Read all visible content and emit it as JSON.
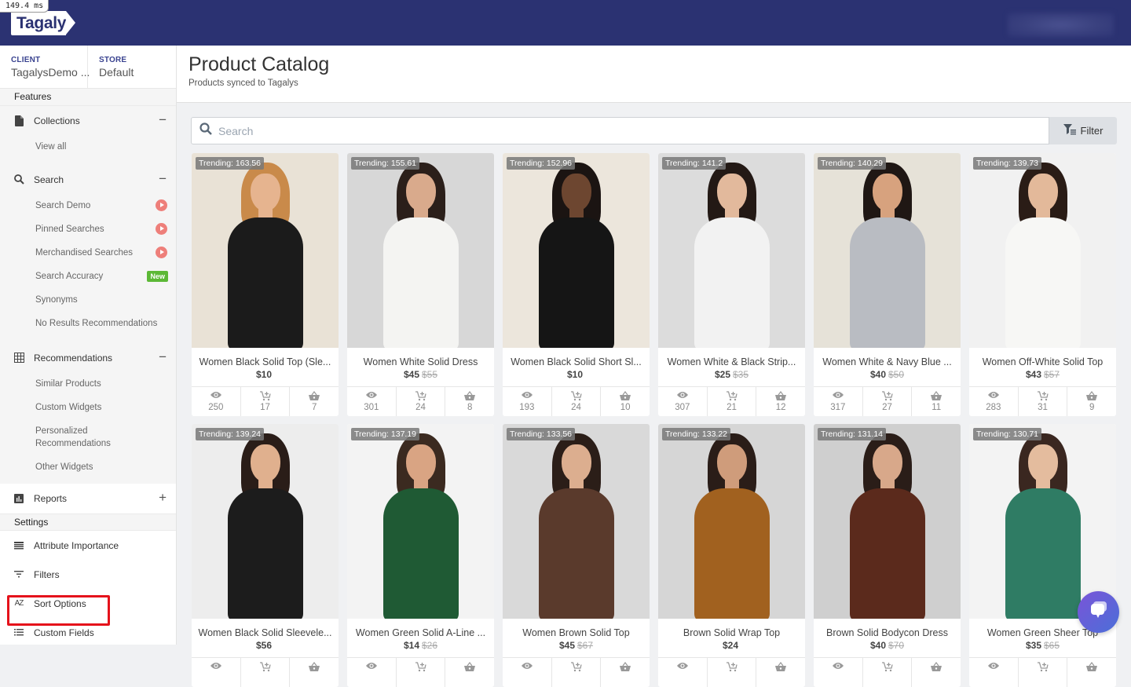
{
  "debug": {
    "timing": "149.4 ms"
  },
  "header": {
    "logo_text": "Tagalys"
  },
  "context": {
    "client_label": "CLIENT",
    "client_value": "TagalysDemo ...",
    "store_label": "STORE",
    "store_value": "Default"
  },
  "sidebar": {
    "features_label": "Features",
    "collections": {
      "label": "Collections",
      "toggle": "−",
      "items": [
        {
          "label": "View all"
        }
      ]
    },
    "search": {
      "label": "Search",
      "toggle": "−",
      "items": [
        {
          "label": "Search Demo",
          "badge": "play"
        },
        {
          "label": "Pinned Searches",
          "badge": "play"
        },
        {
          "label": "Merchandised Searches",
          "badge": "play"
        },
        {
          "label": "Search Accuracy",
          "badge": "New"
        },
        {
          "label": "Synonyms"
        },
        {
          "label": "No Results Recommendations"
        }
      ]
    },
    "recommendations": {
      "label": "Recommendations",
      "toggle": "−",
      "items": [
        {
          "label": "Similar Products"
        },
        {
          "label": "Custom Widgets"
        },
        {
          "label": "Personalized Recommendations"
        },
        {
          "label": "Other Widgets"
        }
      ]
    },
    "reports": {
      "label": "Reports",
      "toggle": "+"
    },
    "settings_label": "Settings",
    "settings_items": [
      {
        "label": "Attribute Importance",
        "icon": "attribute-importance-icon"
      },
      {
        "label": "Filters",
        "icon": "filters-icon"
      },
      {
        "label": "Sort Options",
        "icon": "sort-az-icon",
        "highlighted": true
      },
      {
        "label": "Custom Fields",
        "icon": "list-icon"
      }
    ]
  },
  "page": {
    "title": "Product Catalog",
    "subtitle": "Products synced to Tagalys",
    "search_placeholder": "Search",
    "search_value": "",
    "filter_label": "Filter"
  },
  "products": [
    {
      "trending": "Trending: 163.56",
      "name": "Women Black Solid Top (Sle...",
      "price": "$10",
      "old_price": "",
      "views": "250",
      "add_to_cart": "17",
      "purchases": "7",
      "bg": "#e9e2d6",
      "skin": "#e6b48f",
      "hair": "#c98a4a",
      "cloth": "#1b1b1b"
    },
    {
      "trending": "Trending: 155.61",
      "name": "Women White Solid Dress",
      "price": "$45",
      "old_price": "$55",
      "views": "301",
      "add_to_cart": "24",
      "purchases": "8",
      "bg": "#d7d7d7",
      "skin": "#d9aa8c",
      "hair": "#2b1f1a",
      "cloth": "#f4f4f2"
    },
    {
      "trending": "Trending: 152.96",
      "name": "Women Black Solid Short Sl...",
      "price": "$10",
      "old_price": "",
      "views": "193",
      "add_to_cart": "24",
      "purchases": "10",
      "bg": "#ece6dc",
      "skin": "#6d4630",
      "hair": "#1b1412",
      "cloth": "#151515"
    },
    {
      "trending": "Trending: 141.2",
      "name": "Women White & Black Strip...",
      "price": "$25",
      "old_price": "$35",
      "views": "307",
      "add_to_cart": "21",
      "purchases": "12",
      "bg": "#dcdcdc",
      "skin": "#e2b99c",
      "hair": "#231915",
      "cloth": "#f2f2f2"
    },
    {
      "trending": "Trending: 140.29",
      "name": "Women White & Navy Blue ...",
      "price": "$40",
      "old_price": "$50",
      "views": "317",
      "add_to_cart": "27",
      "purchases": "11",
      "bg": "#e6e2d8",
      "skin": "#d7a27e",
      "hair": "#1f1714",
      "cloth": "#b9bcc2"
    },
    {
      "trending": "Trending: 139.73",
      "name": "Women Off-White Solid Top",
      "price": "$43",
      "old_price": "$57",
      "views": "283",
      "add_to_cart": "31",
      "purchases": "9",
      "bg": "#f1f1f1",
      "skin": "#e3b99a",
      "hair": "#2a1c16",
      "cloth": "#f7f7f5"
    },
    {
      "trending": "Trending: 139.24",
      "name": "Women Black Solid Sleevele...",
      "price": "$56",
      "old_price": "",
      "views": "",
      "add_to_cart": "",
      "purchases": "",
      "bg": "#ededed",
      "skin": "#e0b08e",
      "hair": "#2a1d18",
      "cloth": "#1c1c1c"
    },
    {
      "trending": "Trending: 137.19",
      "name": "Women Green Solid A-Line ...",
      "price": "$14",
      "old_price": "$26",
      "views": "",
      "add_to_cart": "",
      "purchases": "",
      "bg": "#f3f3f3",
      "skin": "#d9a483",
      "hair": "#3b2a20",
      "cloth": "#1f5a34"
    },
    {
      "trending": "Trending: 133.56",
      "name": "Women Brown Solid Top",
      "price": "$45",
      "old_price": "$67",
      "views": "",
      "add_to_cart": "",
      "purchases": "",
      "bg": "#d9d9d9",
      "skin": "#dcae8f",
      "hair": "#2b1e18",
      "cloth": "#5a3a2c"
    },
    {
      "trending": "Trending: 133.22",
      "name": "Brown Solid Wrap Top",
      "price": "$24",
      "old_price": "",
      "views": "",
      "add_to_cart": "",
      "purchases": "",
      "bg": "#d6d6d6",
      "skin": "#cf9c7b",
      "hair": "#2a1d18",
      "cloth": "#a1611f"
    },
    {
      "trending": "Trending: 131.14",
      "name": "Brown Solid Bodycon Dress",
      "price": "$40",
      "old_price": "$70",
      "views": "",
      "add_to_cart": "",
      "purchases": "",
      "bg": "#cfcfcf",
      "skin": "#d8a88a",
      "hair": "#2a1d18",
      "cloth": "#5b2a1c"
    },
    {
      "trending": "Trending: 130.71",
      "name": "Women Green Sheer Top",
      "price": "$35",
      "old_price": "$65",
      "views": "",
      "add_to_cart": "",
      "purchases": "",
      "bg": "#f3f3f3",
      "skin": "#e4bc9e",
      "hair": "#3a2720",
      "cloth": "#2f7c64"
    }
  ],
  "colors": {
    "topbar": "#2b3272",
    "play_badge": "#ee7f7a",
    "new_badge": "#5cb836",
    "highlight": "#e5121b"
  }
}
